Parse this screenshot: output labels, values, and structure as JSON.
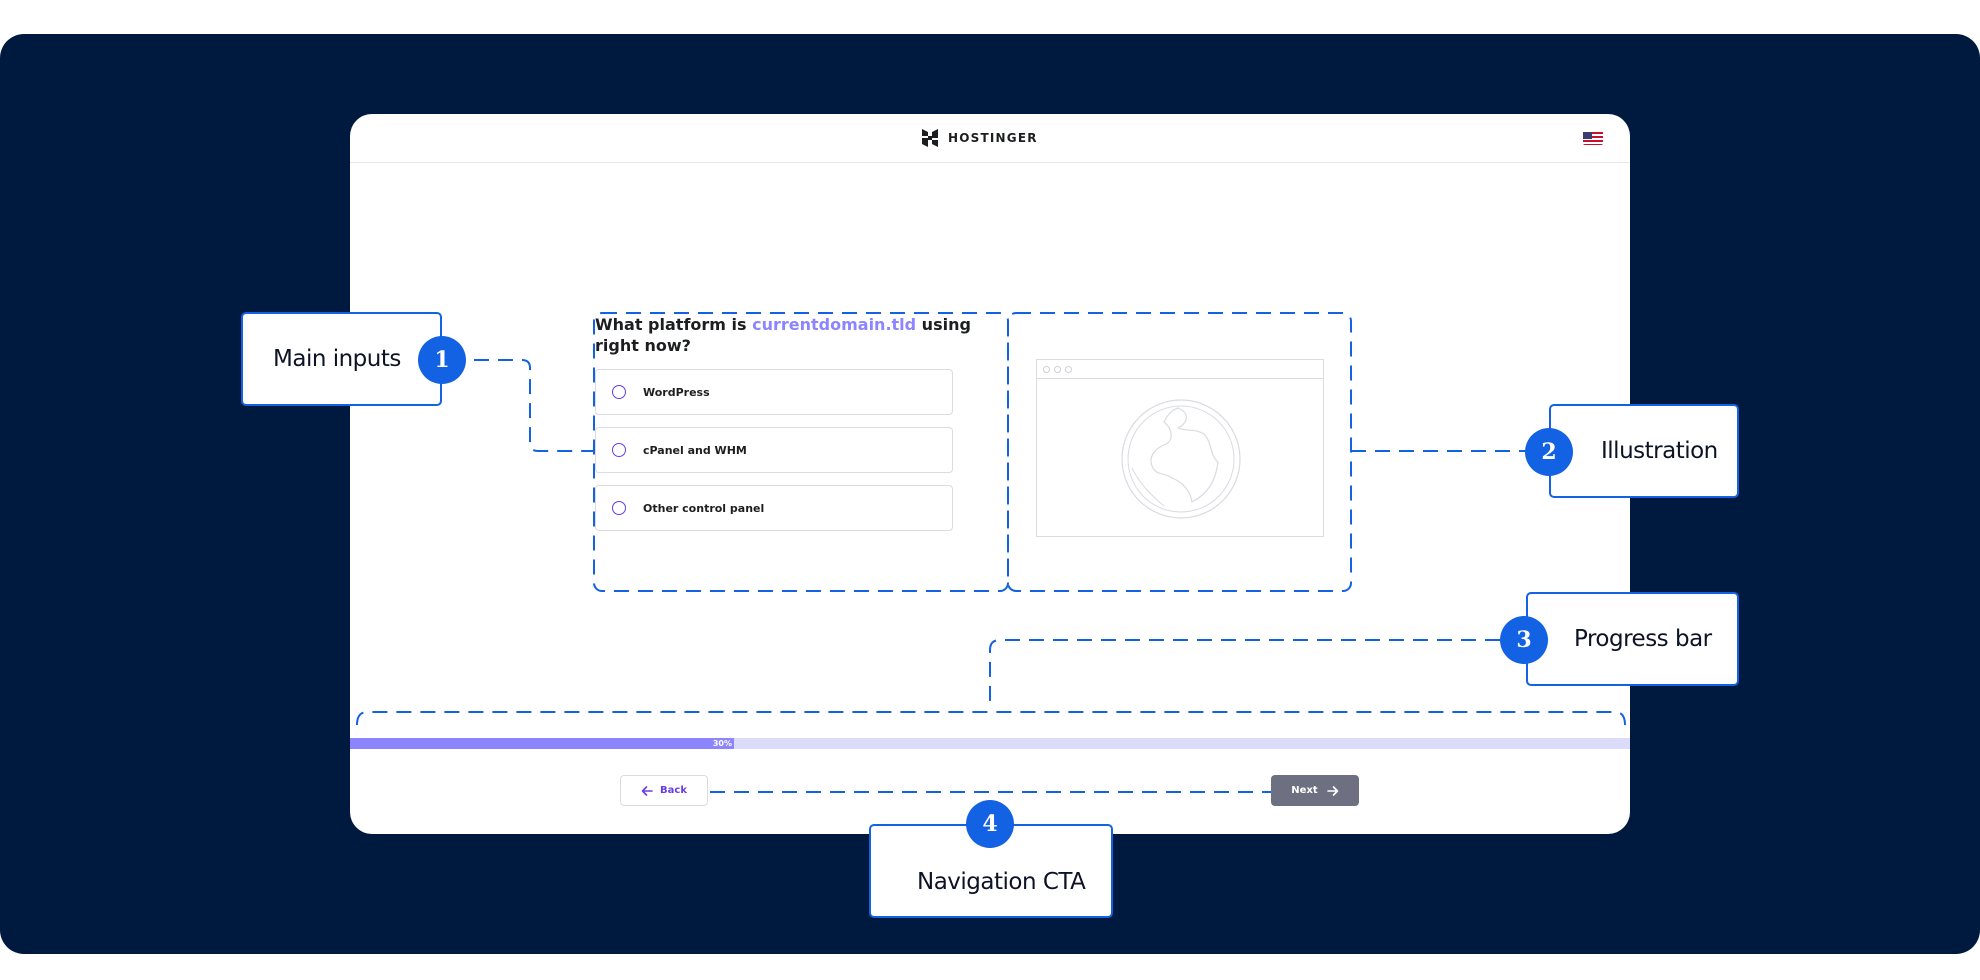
{
  "app": {
    "brand": "HOSTINGER",
    "language_flag": "us-flag-icon"
  },
  "question": {
    "prefix": "What platform is ",
    "domain": "currentdomain.tld",
    "suffix": " using right now?",
    "options": [
      {
        "label": "WordPress"
      },
      {
        "label": "cPanel and WHM"
      },
      {
        "label": "Other control panel"
      }
    ]
  },
  "illustration": {
    "icon": "globe-icon"
  },
  "progress": {
    "value": 0.3,
    "label": "30%"
  },
  "navigation": {
    "back_label": "Back",
    "next_label": "Next"
  },
  "annotations": [
    {
      "number": "1",
      "label": "Main inputs"
    },
    {
      "number": "2",
      "label": "Illustration"
    },
    {
      "number": "3",
      "label": "Progress bar"
    },
    {
      "number": "4",
      "label": "Navigation CTA"
    }
  ],
  "colors": {
    "background": "#00193e",
    "accent": "#673de6",
    "highlight": "#8c85ff",
    "annotation": "#1262e3",
    "next_button": "#6d7081"
  }
}
